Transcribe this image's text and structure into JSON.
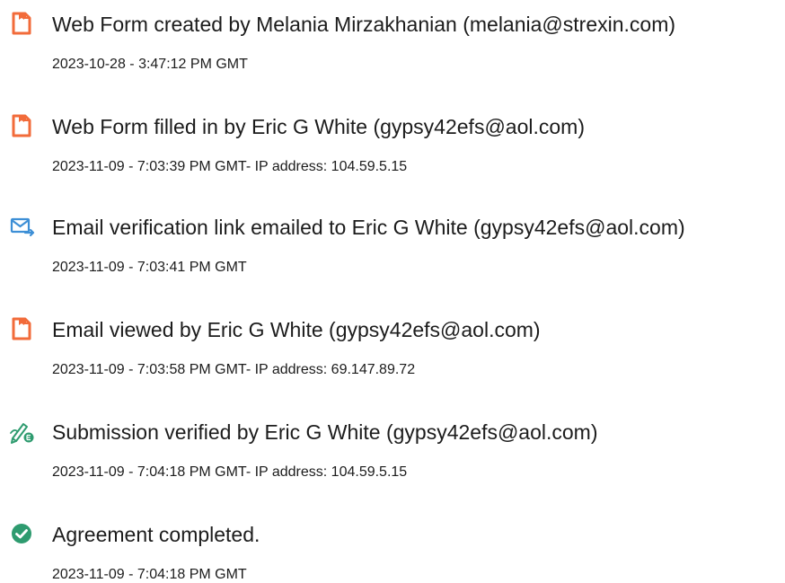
{
  "colors": {
    "document_icon": "#f26b3a",
    "email_icon": "#3d8fd6",
    "verify_icon": "#2e9b6f",
    "complete_icon": "#2e9b6f",
    "text": "#1c1c1c"
  },
  "events": [
    {
      "icon": "document-icon",
      "title": "Web Form created by Melania Mirzakhanian (melania@strexin.com)",
      "meta": "2023-10-28 - 3:47:12 PM GMT"
    },
    {
      "icon": "document-icon",
      "title": "Web Form filled in by Eric G White (gypsy42efs@aol.com)",
      "meta": "2023-11-09 - 7:03:39 PM GMT- IP address: 104.59.5.15"
    },
    {
      "icon": "email-send-icon",
      "title": "Email verification link emailed to Eric G White (gypsy42efs@aol.com)",
      "meta": "2023-11-09 - 7:03:41 PM GMT"
    },
    {
      "icon": "document-icon",
      "title": "Email viewed by Eric G White (gypsy42efs@aol.com)",
      "meta": "2023-11-09 - 7:03:58 PM GMT- IP address: 69.147.89.72"
    },
    {
      "icon": "signature-verified-icon",
      "title": "Submission verified by Eric G White (gypsy42efs@aol.com)",
      "meta": "2023-11-09 - 7:04:18 PM GMT- IP address: 104.59.5.15"
    },
    {
      "icon": "check-circle-icon",
      "title": "Agreement completed.",
      "meta": "2023-11-09 - 7:04:18 PM GMT"
    }
  ]
}
